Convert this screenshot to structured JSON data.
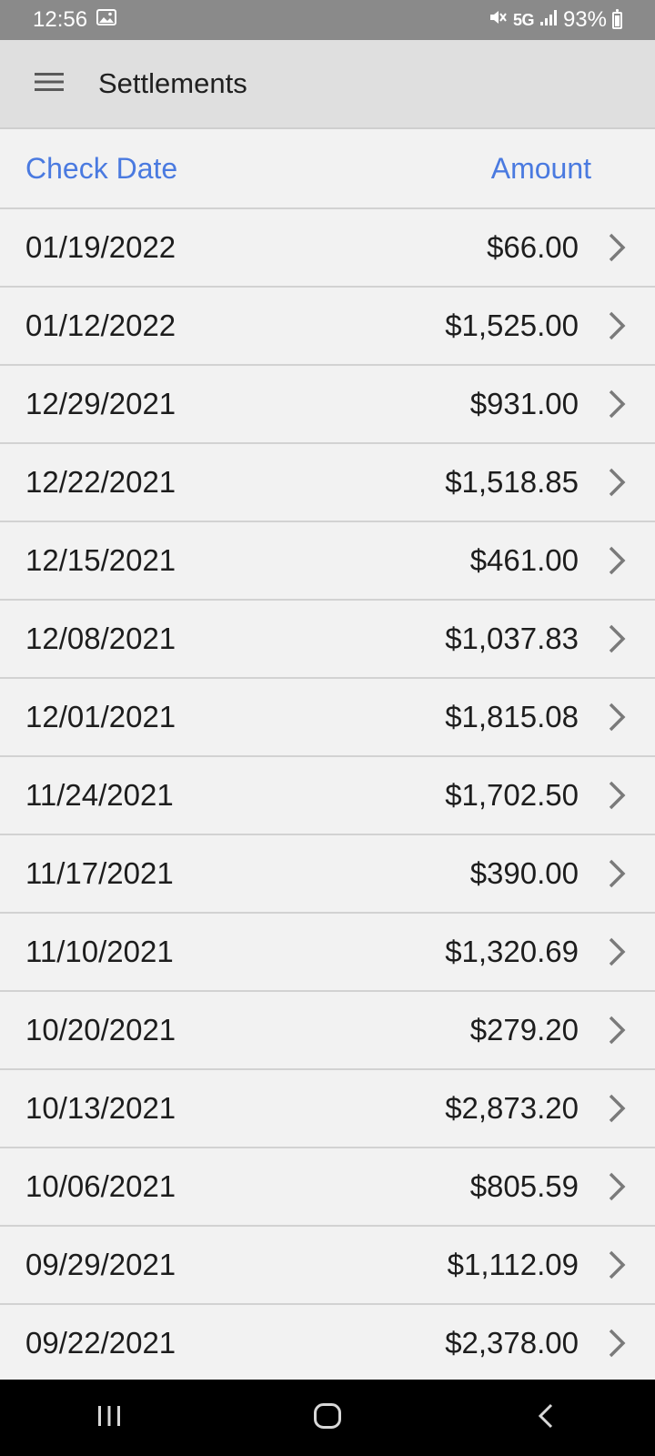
{
  "status_bar": {
    "time": "12:56",
    "network": "5G",
    "battery": "93%"
  },
  "app_bar": {
    "title": "Settlements"
  },
  "table": {
    "columns": [
      "Check Date",
      "Amount"
    ],
    "rows": [
      {
        "date": "01/19/2022",
        "amount": "$66.00"
      },
      {
        "date": "01/12/2022",
        "amount": "$1,525.00"
      },
      {
        "date": "12/29/2021",
        "amount": "$931.00"
      },
      {
        "date": "12/22/2021",
        "amount": "$1,518.85"
      },
      {
        "date": "12/15/2021",
        "amount": "$461.00"
      },
      {
        "date": "12/08/2021",
        "amount": "$1,037.83"
      },
      {
        "date": "12/01/2021",
        "amount": "$1,815.08"
      },
      {
        "date": "11/24/2021",
        "amount": "$1,702.50"
      },
      {
        "date": "11/17/2021",
        "amount": "$390.00"
      },
      {
        "date": "11/10/2021",
        "amount": "$1,320.69"
      },
      {
        "date": "10/20/2021",
        "amount": "$279.20"
      },
      {
        "date": "10/13/2021",
        "amount": "$2,873.20"
      },
      {
        "date": "10/06/2021",
        "amount": "$805.59"
      },
      {
        "date": "09/29/2021",
        "amount": "$1,112.09"
      },
      {
        "date": "09/22/2021",
        "amount": "$2,378.00"
      }
    ]
  },
  "colors": {
    "header_accent": "#4a7ae0",
    "status_bar": "#8a8a8a",
    "app_bar": "#dfdfdf",
    "background": "#f2f2f2"
  }
}
